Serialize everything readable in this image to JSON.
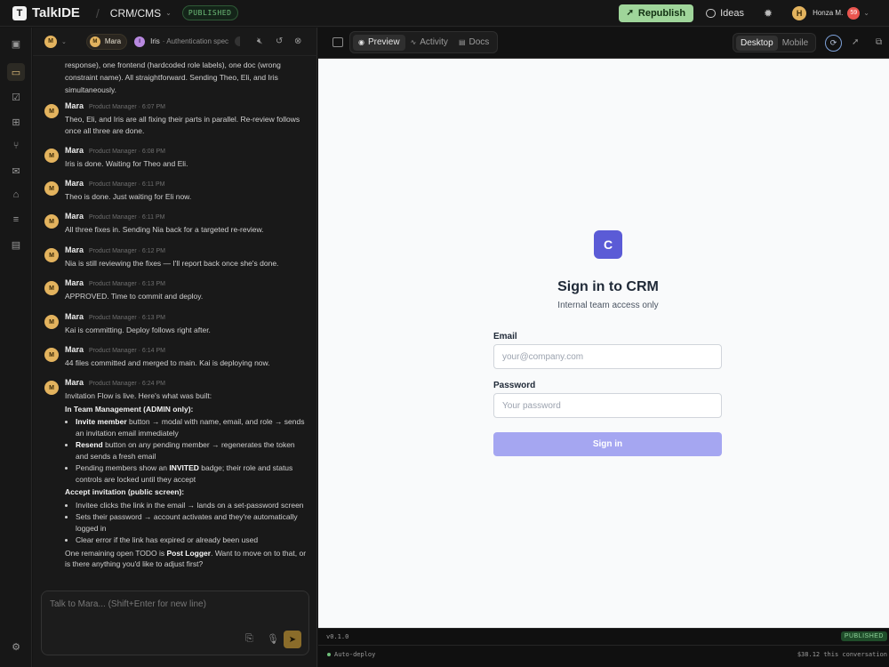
{
  "app": {
    "name": "TalkIDE",
    "project": "CRM/CMS",
    "status_badge": "PUBLISHED",
    "republish": "Republish",
    "ideas": "Ideas",
    "user_initial": "H",
    "user_name": "Honza M.",
    "user_badge": "59"
  },
  "chat": {
    "selector_initial": "M",
    "agents": [
      {
        "initial": "M",
        "name": "Mara"
      },
      {
        "initial": "I",
        "name": "Iris",
        "task": "· Authentication spec"
      }
    ],
    "top_fragment": "response), one frontend (hardcoded role labels), one doc (wrong constraint name). All straightforward. Sending Theo, Eli, and Iris simultaneously.",
    "messages": [
      {
        "initial": "M",
        "author": "Mara",
        "meta": "Product Manager · 6:07 PM",
        "text": "Theo, Eli, and Iris are all fixing their parts in parallel. Re-review follows once all three are done."
      },
      {
        "initial": "M",
        "author": "Mara",
        "meta": "Product Manager · 6:08 PM",
        "text": "Iris is done. Waiting for Theo and Eli."
      },
      {
        "initial": "M",
        "author": "Mara",
        "meta": "Product Manager · 6:11 PM",
        "text": "Theo is done. Just waiting for Eli now."
      },
      {
        "initial": "M",
        "author": "Mara",
        "meta": "Product Manager · 6:11 PM",
        "text": "All three fixes in. Sending Nia back for a targeted re-review."
      },
      {
        "initial": "M",
        "author": "Mara",
        "meta": "Product Manager · 6:12 PM",
        "text": "Nia is still reviewing the fixes — I'll report back once she's done."
      },
      {
        "initial": "M",
        "author": "Mara",
        "meta": "Product Manager · 6:13 PM",
        "text": "APPROVED. Time to commit and deploy."
      },
      {
        "initial": "M",
        "author": "Mara",
        "meta": "Product Manager · 6:13 PM",
        "text": "Kai is committing. Deploy follows right after."
      },
      {
        "initial": "M",
        "author": "Mara",
        "meta": "Product Manager · 6:14 PM",
        "text": "44 files committed and merged to main. Kai is deploying now."
      }
    ],
    "last": {
      "initial": "M",
      "author": "Mara",
      "meta": "Product Manager · 6:24 PM",
      "intro": "Invitation Flow is live. Here's what was built:",
      "section1": "In Team Management (ADMIN only):",
      "b1_bold": "Invite member",
      "b1_rest": " button → modal with name, email, and role → sends an invitation email immediately",
      "b2_bold": "Resend",
      "b2_rest": " button on any pending member → regenerates the token and sends a fresh email",
      "b3_pre": "Pending members show an ",
      "b3_bold": "INVITED",
      "b3_rest": " badge; their role and status controls are locked until they accept",
      "section2": "Accept invitation (public screen):",
      "b4": "Invitee clicks the link in the email → lands on a set-password screen",
      "b5": "Sets their password → account activates and they're automatically logged in",
      "b6": "Clear error if the link has expired or already been used",
      "outro_pre": "One remaining open TODO is ",
      "outro_bold": "Post Logger",
      "outro_rest": ". Want to move on to that, or is there anything you'd like to adjust first?"
    },
    "composer_placeholder": "Talk to Mara... (Shift+Enter for new line)"
  },
  "preview": {
    "tabs": [
      "Preview",
      "Activity",
      "Docs"
    ],
    "devices": [
      "Desktop",
      "Mobile"
    ],
    "logo_letter": "C",
    "title": "Sign in to CRM",
    "subtitle": "Internal team access only",
    "email_label": "Email",
    "email_placeholder": "your@company.com",
    "password_label": "Password",
    "password_placeholder": "Your password",
    "signin_button": "Sign in",
    "version": "v0.1.0",
    "published": "PUBLISHED",
    "auto_deploy": "Auto-deploy",
    "cost": "$38.12 this conversation"
  },
  "colors": {
    "accent_gold": "#e3b35e",
    "republish_green": "#9fd59a",
    "crm_indigo": "#5b5bd6",
    "signin_button": "#a5a6f1"
  }
}
